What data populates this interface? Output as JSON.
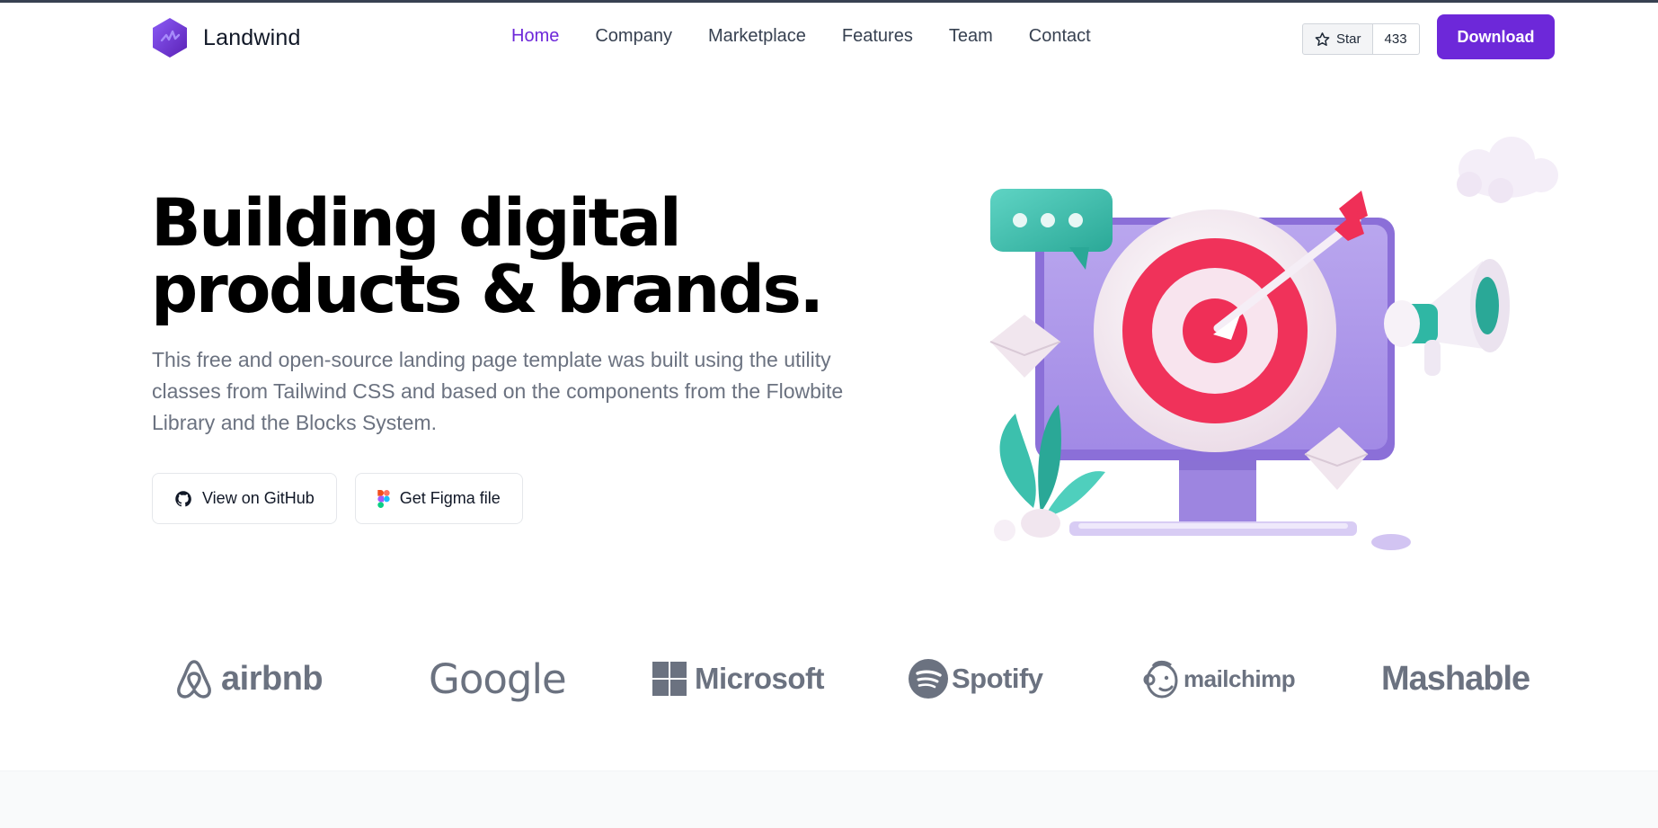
{
  "brand": {
    "name": "Landwind",
    "icon": "landwind-logo-icon",
    "color": "#6d28d9"
  },
  "nav": {
    "items": [
      {
        "label": "Home",
        "active": true
      },
      {
        "label": "Company",
        "active": false
      },
      {
        "label": "Marketplace",
        "active": false
      },
      {
        "label": "Features",
        "active": false
      },
      {
        "label": "Team",
        "active": false
      },
      {
        "label": "Contact",
        "active": false
      }
    ]
  },
  "github_star": {
    "label": "Star",
    "count": "433",
    "icon": "star-icon"
  },
  "download_label": "Download",
  "hero": {
    "title_line1": "Building digital",
    "title_line2": "products & brands.",
    "description": "This free and open-source landing page template was built using the utility classes from Tailwind CSS and based on the components from the Flowbite Library and the Blocks System.",
    "github_button": "View on GitHub",
    "figma_button": "Get Figma file",
    "illustration": "target-monitor-illustration"
  },
  "logos": {
    "airbnb": "airbnb",
    "google": "Google",
    "microsoft": "Microsoft",
    "spotify": "Spotify",
    "mailchimp": "mailchimp",
    "mashable": "Mashable"
  },
  "colors": {
    "accent": "#6d28d9",
    "text_muted": "#6b7280",
    "logo_gray": "#6b7280",
    "band_bg": "#f9fafb"
  }
}
